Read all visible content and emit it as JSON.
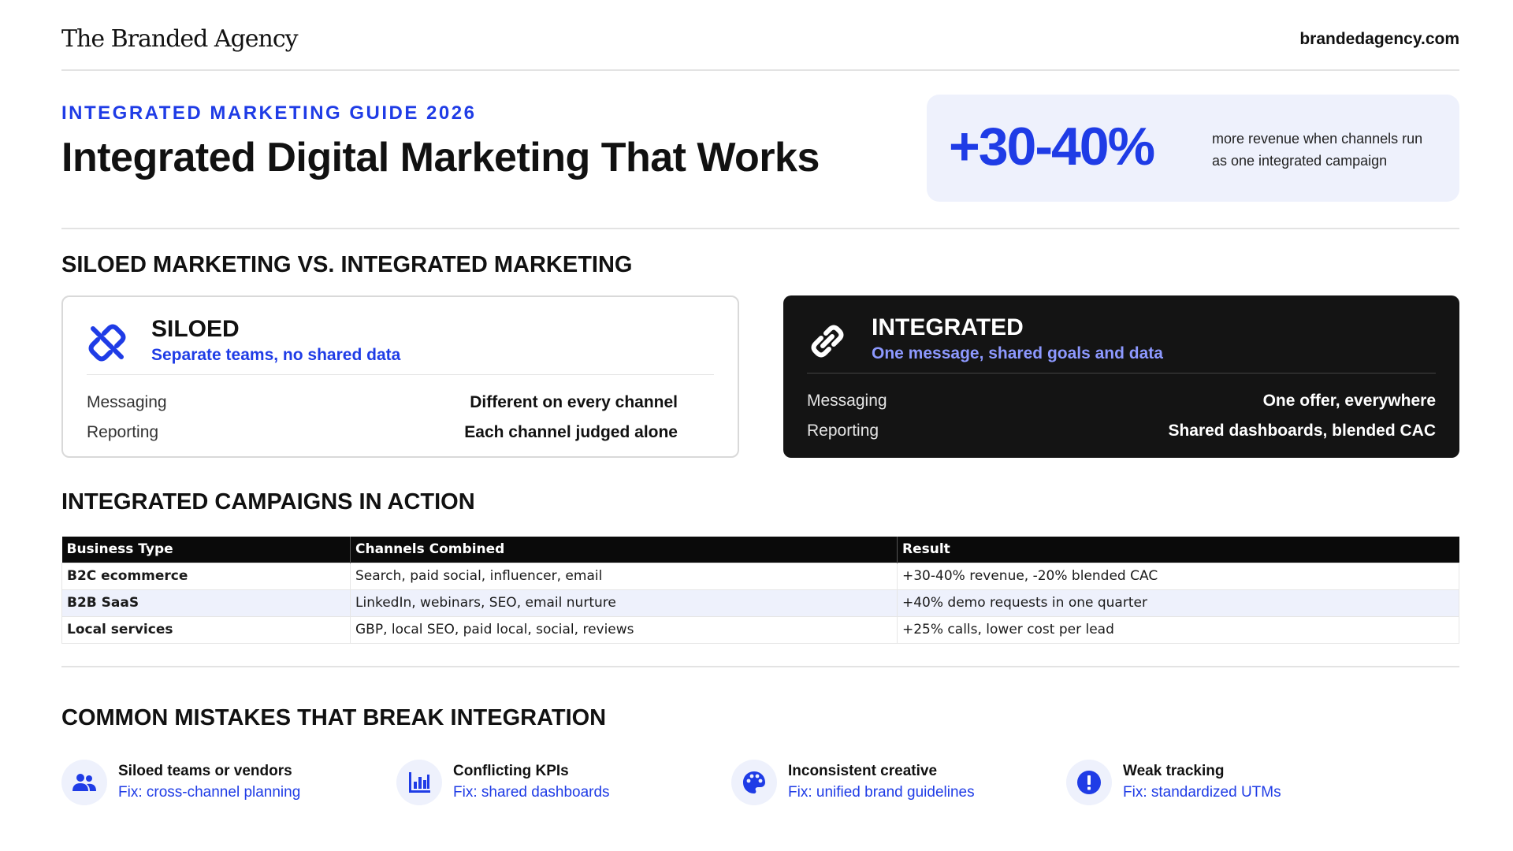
{
  "header": {
    "logo": "The Branded Agency",
    "site": "brandedagency.com"
  },
  "hero": {
    "eyebrow": "INTEGRATED MARKETING GUIDE 2026",
    "title": "Integrated Digital Marketing That Works",
    "stat_value": "+30-40%",
    "stat_text": "more revenue when channels run as one integrated campaign"
  },
  "comparison": {
    "heading": "SILOED MARKETING VS. INTEGRATED MARKETING",
    "siloed": {
      "icon": "link-broken-icon",
      "title": "SILOED",
      "subtitle": "Separate teams, no shared data",
      "rows": [
        {
          "label": "Messaging",
          "value": "Different on every channel"
        },
        {
          "label": "Reporting",
          "value": "Each channel judged alone"
        }
      ]
    },
    "integrated": {
      "icon": "link-icon",
      "title": "INTEGRATED",
      "subtitle": "One message, shared goals and data",
      "rows": [
        {
          "label": "Messaging",
          "value": "One offer, everywhere"
        },
        {
          "label": "Reporting",
          "value": "Shared dashboards, blended CAC"
        }
      ]
    }
  },
  "campaigns": {
    "heading": "INTEGRATED CAMPAIGNS IN ACTION",
    "columns": [
      "Business Type",
      "Channels Combined",
      "Result"
    ],
    "rows": [
      [
        "B2C ecommerce",
        "Search, paid social, influencer, email",
        "+30-40% revenue, -20% blended CAC"
      ],
      [
        "B2B SaaS",
        "LinkedIn, webinars, SEO, email nurture",
        "+40% demo requests in one quarter"
      ],
      [
        "Local services",
        "GBP, local SEO, paid local, social, reviews",
        "+25% calls, lower cost per lead"
      ]
    ]
  },
  "mistakes": {
    "heading": "COMMON MISTAKES THAT BREAK INTEGRATION",
    "items": [
      {
        "icon": "people-icon",
        "title": "Siloed teams or vendors",
        "fix": "Fix: cross-channel planning"
      },
      {
        "icon": "bar-chart-icon",
        "title": "Conflicting KPIs",
        "fix": "Fix: shared dashboards"
      },
      {
        "icon": "palette-icon",
        "title": "Inconsistent creative",
        "fix": "Fix: unified brand guidelines"
      },
      {
        "icon": "alert-icon",
        "title": "Weak tracking",
        "fix": "Fix: standardized UTMs"
      }
    ]
  },
  "colors": {
    "accent": "#1f3ce6",
    "accent_light": "#8d99ff",
    "tint": "#eef1fc",
    "dark": "#141414"
  }
}
